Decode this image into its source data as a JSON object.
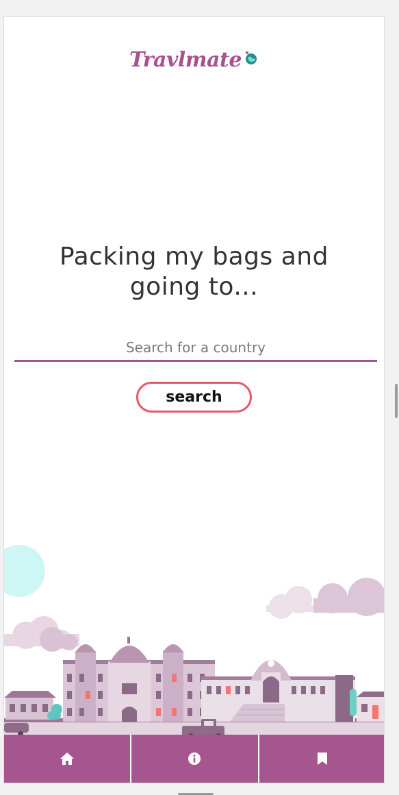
{
  "brand": {
    "logo_text": "Travlmate"
  },
  "hero": {
    "headline_line1": "Packing my bags and",
    "headline_line2": "going to..."
  },
  "search": {
    "placeholder": "Search for a country",
    "value": "",
    "button_label": "search"
  },
  "bottom_nav": [
    {
      "icon": "home-icon"
    },
    {
      "icon": "info-icon"
    },
    {
      "icon": "bookmark-icon"
    }
  ],
  "colors": {
    "accent": "#a5528f",
    "button_border": "#e65a6a",
    "headline": "#333333"
  }
}
